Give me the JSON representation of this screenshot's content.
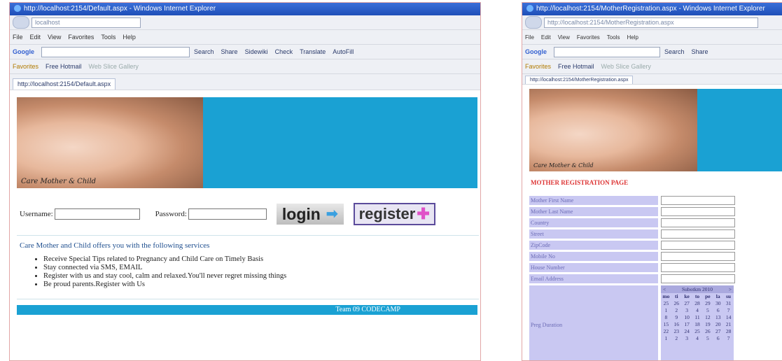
{
  "left": {
    "window_title": "http://localhost:2154/Default.aspx - Windows Internet Explorer",
    "address_host": "localhost",
    "address_text": "http://localhost:2154/Default.aspx",
    "menu": [
      "File",
      "Edit",
      "View",
      "Favorites",
      "Tools",
      "Help"
    ],
    "google_label": "Google",
    "toolbar_items": [
      "Search",
      "Share",
      "Sidewiki",
      "Check",
      "Translate",
      "AutoFill"
    ],
    "favorites_label": "Favorites",
    "favorites_links": [
      "Free Hotmail",
      "Web Slice Gallery"
    ],
    "tab_label": "http://localhost:2154/Default.aspx",
    "banner_caption": "Care Mother & Child",
    "username_label": "Username:",
    "password_label": "Password:",
    "login_label": "login",
    "register_label": "register",
    "services_title": "Care Mother and Child offers you with the following services",
    "services": [
      "Receive Special Tips related to Pregnancy and Child Care on Timely Basis",
      "Stay connected via SMS, EMAIL",
      "Register with us and stay cool, calm and relaxed.You'll never regret missing things",
      "Be proud parents.Register with Us"
    ],
    "footer": "Team 09 CODECAMP"
  },
  "right": {
    "window_title": "http://localhost:2154/MotherRegistration.aspx - Windows Internet Explorer",
    "address_text": "http://localhost:2154/MotherRegistration.aspx",
    "menu": [
      "File",
      "Edit",
      "View",
      "Favorites",
      "Tools",
      "Help"
    ],
    "google_label": "Google",
    "toolbar_items": [
      "Search",
      "Share"
    ],
    "favorites_label": "Favorites",
    "favorites_links": [
      "Free Hotmail",
      "Web Slice Gallery"
    ],
    "tab_label": "http://localhost:2154/MotherRegistration.aspx",
    "banner_caption": "Care Mother & Child",
    "page_title": "MOTHER REGISTRATION PAGE",
    "fields": [
      "Mother First Name",
      "Mother Last Name",
      "Country",
      "Street",
      "ZipCode",
      "Mobile No",
      "House Number",
      "Email Address"
    ],
    "calendar_field": "Preg Duration",
    "calendar": {
      "prev": "<",
      "month": "Subotkm 2010",
      "next": ">",
      "dow": [
        "mo",
        "ti",
        "ke",
        "to",
        "pe",
        "la",
        "su"
      ],
      "weeks": [
        [
          "25",
          "26",
          "27",
          "28",
          "29",
          "30",
          "31"
        ],
        [
          "1",
          "2",
          "3",
          "4",
          "5",
          "6",
          "7"
        ],
        [
          "8",
          "9",
          "10",
          "11",
          "12",
          "13",
          "14"
        ],
        [
          "15",
          "16",
          "17",
          "18",
          "19",
          "20",
          "21"
        ],
        [
          "22",
          "23",
          "24",
          "25",
          "26",
          "27",
          "28"
        ],
        [
          "1",
          "2",
          "3",
          "4",
          "5",
          "6",
          "7"
        ]
      ]
    }
  }
}
